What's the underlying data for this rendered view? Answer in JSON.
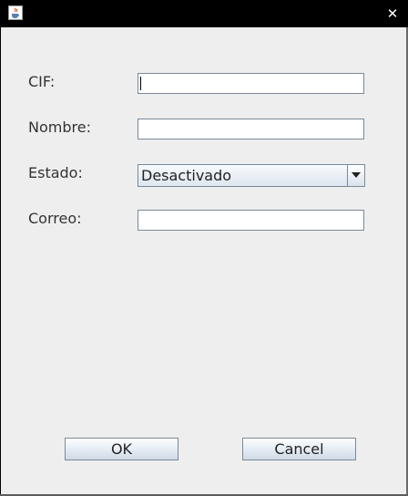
{
  "window": {
    "close_symbol": "✕"
  },
  "form": {
    "fields": [
      {
        "label": "CIF:",
        "value": ""
      },
      {
        "label": "Nombre:",
        "value": ""
      },
      {
        "label": "Estado:",
        "value": "Desactivado"
      },
      {
        "label": "Correo:",
        "value": ""
      }
    ]
  },
  "buttons": {
    "ok_label": "OK",
    "cancel_label": "Cancel"
  },
  "icons": {
    "app_icon": "java-cup-icon",
    "close_icon": "close-icon",
    "dropdown_icon": "triangle-down-icon"
  },
  "colors": {
    "titlebar": "#000000",
    "panel_background": "#eeeeee",
    "field_border": "#7a8a99",
    "button_gradient_top": "#fdfefe",
    "button_gradient_bottom": "#cfdbe7"
  }
}
